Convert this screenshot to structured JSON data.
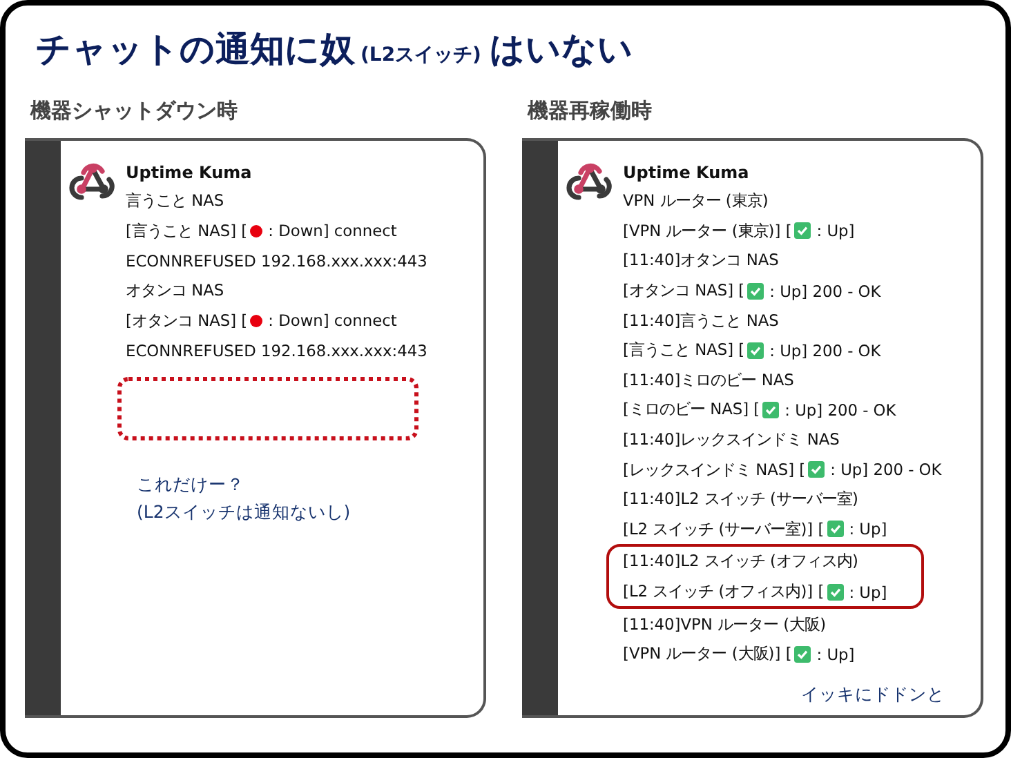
{
  "title": {
    "main": "チャットの通知に奴",
    "aside": "(L2スイッチ)",
    "end": "はいない"
  },
  "panels": [
    {
      "heading": "機器シャットダウン時",
      "sender": "Uptime Kuma",
      "empty_slot": true,
      "lines": [
        {
          "text": "言うこと NAS",
          "highlighted": false
        },
        {
          "prefix": "[言うこと NAS] [",
          "kind": "down",
          "suffix": ": Down] connect",
          "highlighted": false
        },
        {
          "text": "ECONNREFUSED 192.168.xxx.xxx:443",
          "highlighted": false
        },
        {
          "text": "オタンコ NAS",
          "highlighted": false
        },
        {
          "prefix": "[オタンコ NAS] [",
          "kind": "down",
          "suffix": ": Down] connect",
          "highlighted": false
        },
        {
          "text": "ECONNREFUSED 192.168.xxx.xxx:443",
          "highlighted": false
        }
      ],
      "notes": [
        "これだけー？",
        "(L2スイッチは通知ないし)"
      ]
    },
    {
      "heading": "機器再稼働時",
      "sender": "Uptime Kuma",
      "empty_slot": false,
      "lines": [
        {
          "text": "VPN ルーター (東京)",
          "highlighted": false
        },
        {
          "prefix": "[VPN ルーター (東京)] [",
          "kind": "up",
          "suffix": ": Up]",
          "highlighted": false
        },
        {
          "text": "[11:40]オタンコ NAS",
          "highlighted": false
        },
        {
          "prefix": "[オタンコ NAS] [",
          "kind": "up",
          "suffix": ": Up] 200 - OK",
          "highlighted": false
        },
        {
          "text": "[11:40]言うこと NAS",
          "highlighted": false
        },
        {
          "prefix": "[言うこと NAS] [",
          "kind": "up",
          "suffix": ": Up] 200 - OK",
          "highlighted": false
        },
        {
          "text": "[11:40]ミロのビー NAS",
          "highlighted": false
        },
        {
          "prefix": "[ミロのビー NAS] [",
          "kind": "up",
          "suffix": ": Up] 200 - OK",
          "highlighted": false
        },
        {
          "text": "[11:40]レックスインドミ NAS",
          "highlighted": false
        },
        {
          "prefix": "[レックスインドミ NAS] [",
          "kind": "up",
          "suffix": ": Up] 200 - OK",
          "highlighted": false
        },
        {
          "text": "[11:40]L2 スイッチ (サーバー室)",
          "highlighted": false
        },
        {
          "prefix": "[L2 スイッチ (サーバー室)] [",
          "kind": "up",
          "suffix": ": Up]",
          "highlighted": false
        },
        {
          "text": "[11:40]L2 スイッチ (オフィス内)",
          "highlighted": true
        },
        {
          "prefix": "[L2 スイッチ (オフィス内)] [",
          "kind": "up",
          "suffix": ": Up]",
          "highlighted": true
        },
        {
          "text": "[11:40]VPN ルーター (大阪)",
          "highlighted": false
        },
        {
          "prefix": "[VPN ルーター (大阪)] [",
          "kind": "up",
          "suffix": ": Up]",
          "highlighted": false
        }
      ],
      "notes": [
        "イッキにドドンと"
      ]
    }
  ]
}
